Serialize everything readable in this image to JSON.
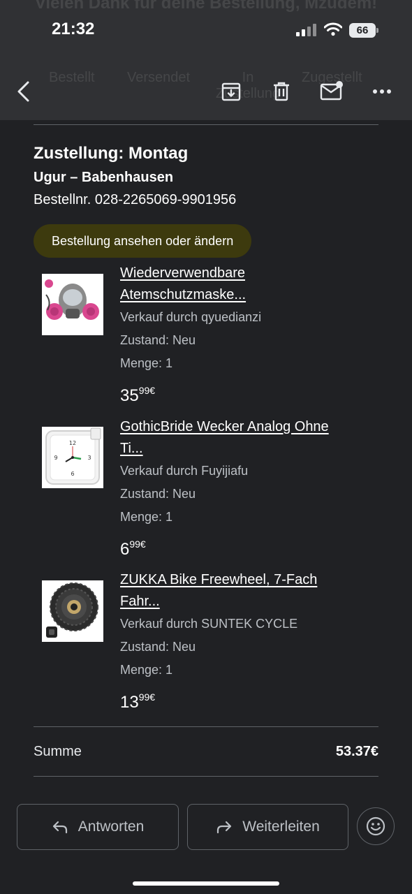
{
  "status_bar": {
    "time": "21:32",
    "battery": "66"
  },
  "header": {
    "title_ghost": "Vielen Dank für deine Bestellung, Mzudem!",
    "steps_ghost": [
      "Bestellt",
      "Versendet",
      "In Zustellung",
      "Zugestellt"
    ]
  },
  "order": {
    "delivery": "Zustellung: Montag",
    "recipient": "Ugur – Babenhausen",
    "order_number": "Bestellnr. 028-2265069-9901956",
    "view_button": "Bestellung ansehen oder ändern"
  },
  "items": [
    {
      "name_line1": "Wiederverwendbare",
      "name_line2": "Atemschutzmaske...",
      "seller": "Verkauf durch qyuedianzi",
      "condition": "Zustand: Neu",
      "quantity": "Menge: 1",
      "price_whole": "35",
      "price_cents": "99€"
    },
    {
      "name_line1": "GothicBride Wecker Analog Ohne",
      "name_line2": "Ti...",
      "seller": "Verkauf durch Fuyijiafu",
      "condition": "Zustand: Neu",
      "quantity": "Menge: 1",
      "price_whole": "6",
      "price_cents": "99€"
    },
    {
      "name_line1": "ZUKKA Bike Freewheel, 7-Fach",
      "name_line2": "Fahr...",
      "seller": "Verkauf durch SUNTEK CYCLE",
      "condition": "Zustand: Neu",
      "quantity": "Menge: 1",
      "price_whole": "13",
      "price_cents": "99€"
    }
  ],
  "summary": {
    "label": "Summe",
    "value": "53.37€"
  },
  "actions": {
    "reply": "Antworten",
    "forward": "Weiterleiten"
  },
  "icons": {
    "back": "back-arrow-icon",
    "archive": "archive-icon",
    "delete": "trash-icon",
    "unread": "mark-unread-icon",
    "more": "more-icon",
    "emoji": "emoji-icon"
  },
  "colors": {
    "background": "#202124",
    "toolbar": "#303134",
    "order_button": "#3d3a0e"
  }
}
